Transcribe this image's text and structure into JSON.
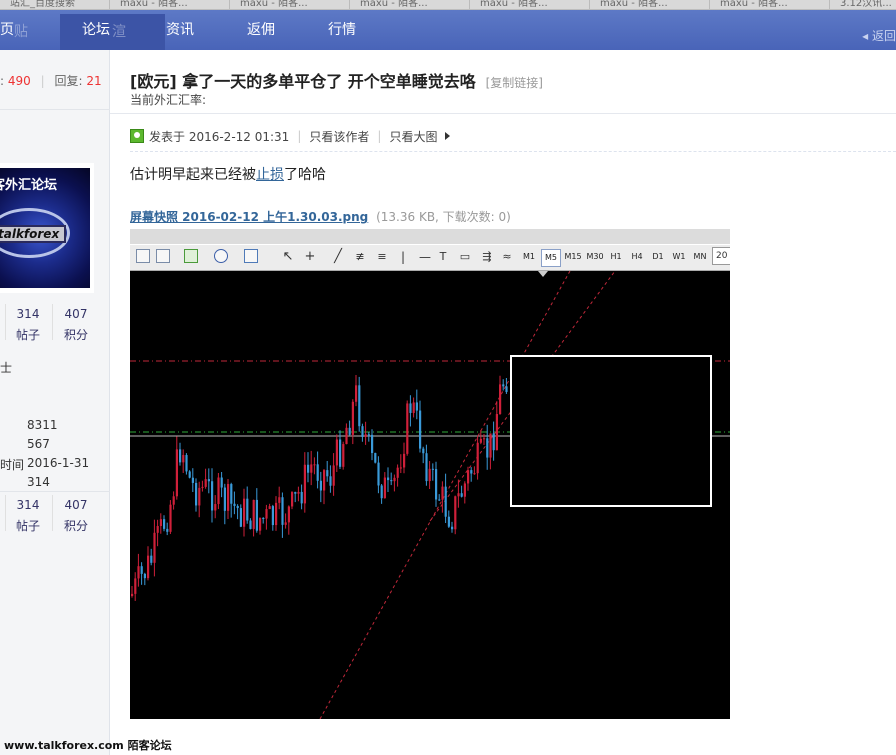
{
  "browser_tabs": [
    "站汇_百度搜索",
    "maxu - 陌客...",
    "maxu - 陌客...",
    "maxu - 陌客...",
    "maxu - 陌客...",
    "maxu - 陌客...",
    "maxu - 陌客...",
    "3.12汉讯..."
  ],
  "nav": {
    "items": [
      "页",
      "论坛",
      "资讯",
      "返佣",
      "行情"
    ],
    "ghost_left": "贴",
    "ghost_mid": "渲",
    "back": "返回"
  },
  "left": {
    "view_label": ":",
    "views": "490",
    "replies_label": "回复:",
    "replies": "21",
    "avatar_title": "客外汇论坛",
    "avatar_band": "talkforex",
    "stats1": {
      "a": "314",
      "b": "407",
      "b_label": "积分",
      "a_label": "帖子"
    },
    "title_badge": "士",
    "profile": [
      {
        "label": "",
        "value": "8311"
      },
      {
        "label": "",
        "value": "567"
      },
      {
        "label": "时间",
        "value": "2016-1-31"
      },
      {
        "label": "",
        "value": "314"
      }
    ],
    "stats2": {
      "a": "314",
      "b": "407",
      "b_label": "积分",
      "a_label": "帖子"
    }
  },
  "post": {
    "title": "[欧元] 拿了一天的多单平仓了 开个空单睡觉去咯",
    "copy_link": "[复制链接]",
    "subtitle": "当前外汇汇率:",
    "posted_at": "发表于 2016-2-12 01:31",
    "only_author": "只看该作者",
    "big_image": "只看大图",
    "body_before": "估计明早起来已经被",
    "body_link": "止损",
    "body_after": "了哈哈",
    "attachment_name": "屏幕快照 2016-02-12 上午1.30.03.png",
    "attachment_info": "(13.36 KB, 下载次数: 0)"
  },
  "mt_toolbar": {
    "timeframes": [
      "M1",
      "M5",
      "M15",
      "M30",
      "H1",
      "H4",
      "D1",
      "W1",
      "MN"
    ],
    "active_timeframe": "M5",
    "input": "20"
  },
  "colors": {
    "nav_bg": "#4f6bbf",
    "bull": "#d0203a",
    "bear": "#3a9ad9",
    "red_line": "#c0283a",
    "green_line": "#2faa3a"
  },
  "footer": "www.talkforex.com 陌客论坛"
}
